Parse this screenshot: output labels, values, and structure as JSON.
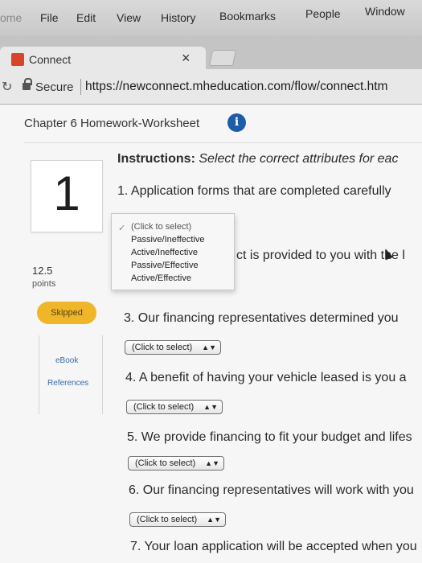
{
  "menubar": {
    "items": [
      "ome",
      "File",
      "Edit",
      "View",
      "History",
      "Bookmarks",
      "People",
      "Window"
    ]
  },
  "tab": {
    "title": "Connect",
    "close": "×"
  },
  "address": {
    "secure_label": "Secure",
    "url": "https://newconnect.mheducation.com/flow/connect.htm"
  },
  "page": {
    "chapter_title": "Chapter 6 Homework-Worksheet",
    "info_icon": "i",
    "question_number": "1",
    "points_value": "12.5",
    "points_label": "points",
    "status_badge": "Skipped",
    "links": {
      "ebook": "eBook",
      "references": "References"
    },
    "instructions_bold": "Instructions:",
    "instructions_text": " Select the correct attributes for eac"
  },
  "questions": [
    {
      "text": "1. Application forms that are completed carefully"
    },
    {
      "text": "ct is provided to you with the l"
    },
    {
      "text": "3. Our financing representatives determined you"
    },
    {
      "text": "4. A benefit of having your vehicle leased is you a"
    },
    {
      "text": "5. We provide financing to fit your budget and lifes"
    },
    {
      "text": "6. Our financing representatives will work with you"
    },
    {
      "text": "7. Your loan application will be accepted when you"
    }
  ],
  "select_label": "(Click to select)",
  "select_arrows": "▲▼",
  "dropdown": {
    "check": "✓",
    "options": [
      "(Click to select)",
      "Passive/Ineffective",
      "Active/Ineffective",
      "Passive/Effective",
      "Active/Effective"
    ]
  },
  "colors": {
    "badge": "#f0b62a",
    "info": "#1f5ca8",
    "link": "#3a6aa8",
    "favicon": "#d9452b"
  }
}
